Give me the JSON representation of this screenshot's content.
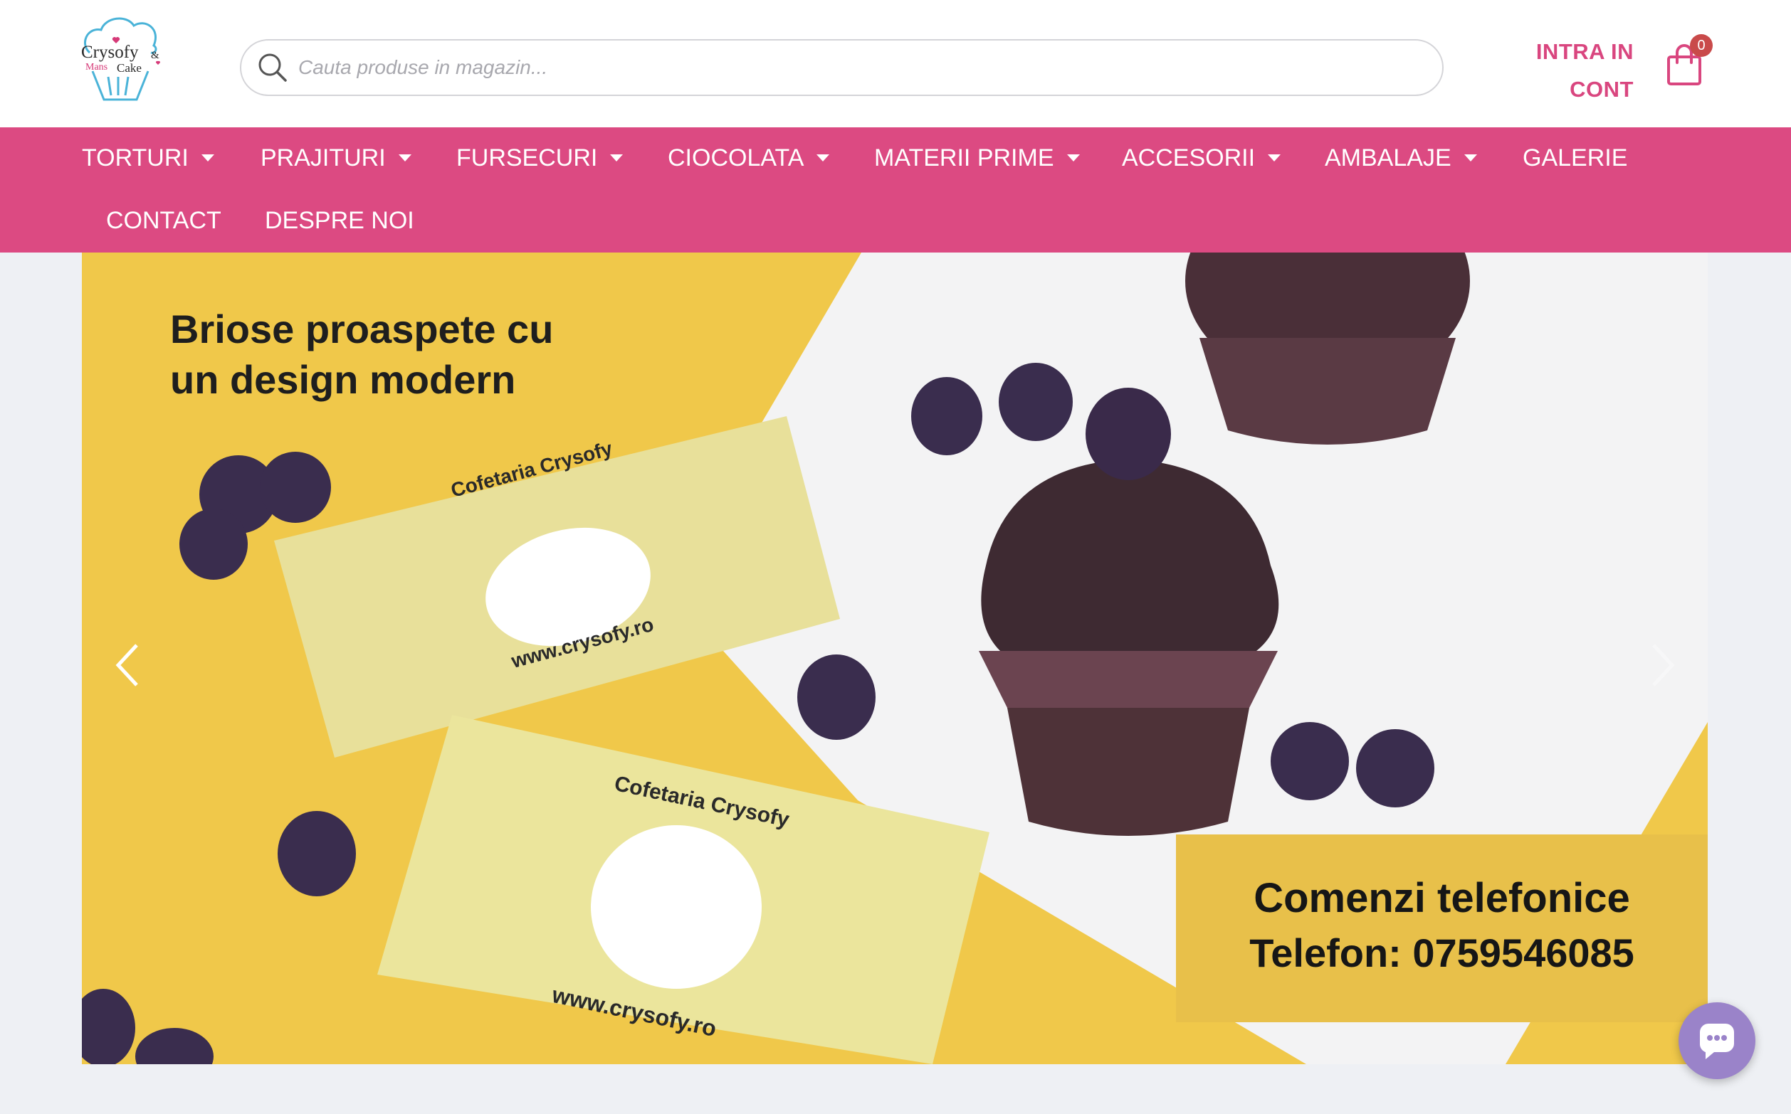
{
  "brand": {
    "name": "Crysofy",
    "ampersand": "&",
    "sub1": "Mans",
    "sub2": "Cake",
    "colors": {
      "primary": "#dc4a82",
      "accent": "#d9467f",
      "banner_yellow": "#f0c84a"
    }
  },
  "search": {
    "placeholder": "Cauta produse in magazin...",
    "value": "",
    "icon": "search-icon"
  },
  "account": {
    "login_line1": "INTRA IN",
    "login_line2": "CONT"
  },
  "cart": {
    "count": "0",
    "icon": "shopping-bag-icon"
  },
  "nav": {
    "items": [
      {
        "label": "TORTURI",
        "has_dropdown": true
      },
      {
        "label": "PRAJITURI",
        "has_dropdown": true
      },
      {
        "label": "FURSECURI",
        "has_dropdown": true
      },
      {
        "label": "CIOCOLATA",
        "has_dropdown": true
      },
      {
        "label": "MATERII PRIME",
        "has_dropdown": true
      },
      {
        "label": "ACCESORII",
        "has_dropdown": true
      },
      {
        "label": "AMBALAJE",
        "has_dropdown": true
      },
      {
        "label": "GALERIE",
        "has_dropdown": false
      },
      {
        "label": "CONTACT",
        "has_dropdown": false
      },
      {
        "label": "DESPRE NOI",
        "has_dropdown": false
      }
    ]
  },
  "banner": {
    "headline_line1": "Briose proaspete cu",
    "headline_line2": "un design modern",
    "card_title": "Cofetaria Crysofy",
    "card_url": "www.crysofy.ro",
    "promo_line1": "Comenzi telefonice",
    "promo_line2": "Telefon: 0759546085"
  },
  "chat": {
    "icon": "chat-bubble-icon"
  }
}
